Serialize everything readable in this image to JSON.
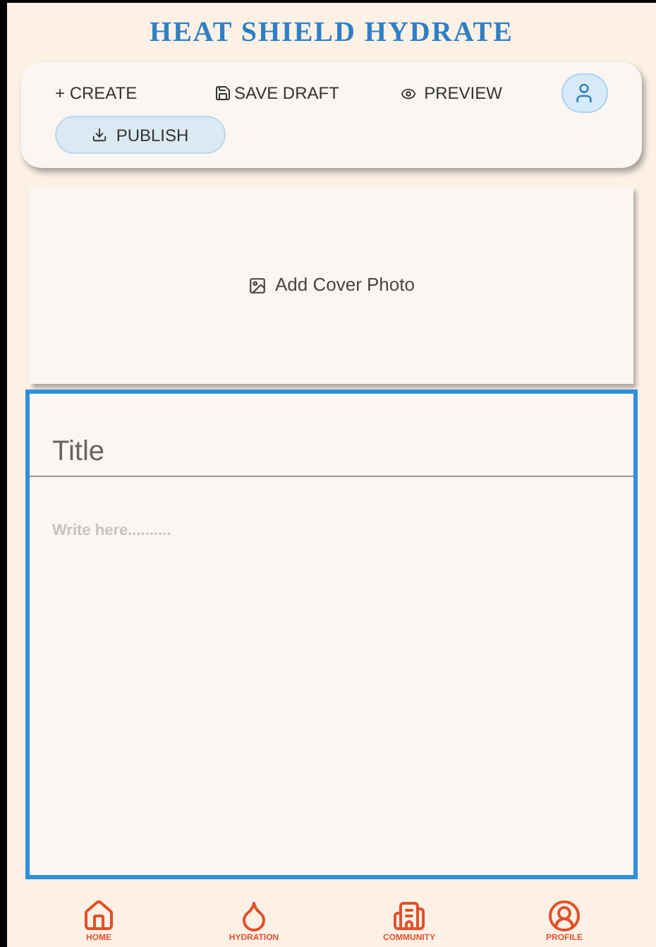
{
  "app_title": "HEAT SHIELD HYDRATE",
  "toolbar": {
    "create": "+ CREATE",
    "save_draft": "SAVE DRAFT",
    "preview": "PREVIEW",
    "publish": "PUBLISH"
  },
  "cover": {
    "label": "Add Cover Photo"
  },
  "editor": {
    "title_placeholder": "Title",
    "body_placeholder": "Write here.........."
  },
  "nav": [
    {
      "kind": "home",
      "label": "HOME"
    },
    {
      "kind": "hydration",
      "label": "HYDRATION"
    },
    {
      "kind": "community",
      "label": "COMMUNITY"
    },
    {
      "kind": "profile",
      "label": "PROFILE"
    }
  ]
}
